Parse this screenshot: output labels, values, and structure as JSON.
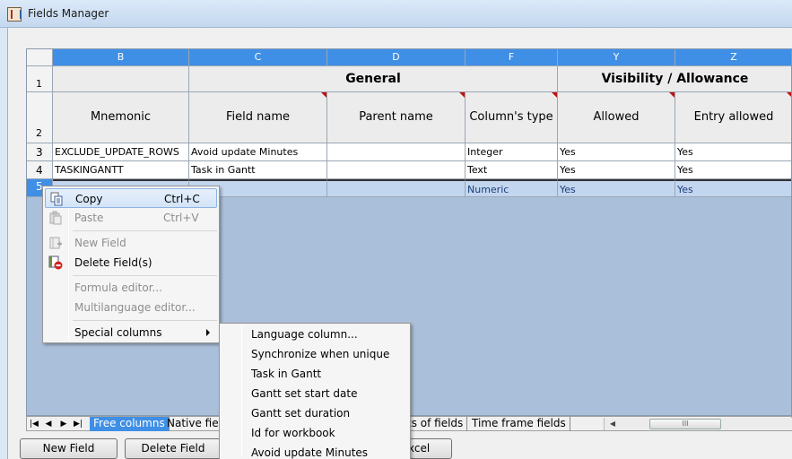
{
  "window": {
    "title": "Fields Manager"
  },
  "grid": {
    "columns": [
      {
        "letter": "B"
      },
      {
        "letter": "C"
      },
      {
        "letter": "D"
      },
      {
        "letter": "F"
      },
      {
        "letter": "Y"
      },
      {
        "letter": "Z"
      }
    ],
    "rows": [
      "1",
      "2",
      "3",
      "4",
      "5"
    ],
    "groups": {
      "general": "General",
      "visibility": "Visibility / Allowance"
    },
    "headers": {
      "mnemonic": "Mnemonic",
      "field_name": "Field name",
      "parent_name": "Parent name",
      "column_type": "Column's type",
      "allowed": "Allowed",
      "entry_allowed": "Entry allowed"
    },
    "data": [
      {
        "mnemonic": "EXCLUDE_UPDATE_ROWS",
        "field_name": "Avoid update Minutes",
        "parent_name": "",
        "column_type": "Integer",
        "allowed": "Yes",
        "entry_allowed": "Yes"
      },
      {
        "mnemonic": "TASKINGANTT",
        "field_name": "Task in Gantt",
        "parent_name": "",
        "column_type": "Text",
        "allowed": "Yes",
        "entry_allowed": "Yes"
      },
      {
        "mnemonic": "",
        "field_name": "",
        "parent_name": "",
        "column_type": "Numeric",
        "allowed": "Yes",
        "entry_allowed": "Yes"
      }
    ]
  },
  "tabs": {
    "items": [
      "Free columns",
      "Native fiel",
      "ts of fields",
      "Time frame fields"
    ],
    "scroll_thumb": "III"
  },
  "buttons": {
    "new_field": "New Field",
    "delete_field": "Delete Field",
    "excel": "xcel"
  },
  "context_menu": {
    "copy": {
      "label": "Copy",
      "shortcut": "Ctrl+C"
    },
    "paste": {
      "label": "Paste",
      "shortcut": "Ctrl+V"
    },
    "new_field": {
      "label": "New Field"
    },
    "delete_fields": {
      "label": "Delete Field(s)"
    },
    "formula_editor": {
      "label": "Formula editor..."
    },
    "multilanguage_editor": {
      "label": "Multilanguage editor..."
    },
    "special_columns": {
      "label": "Special columns"
    }
  },
  "submenu": [
    "Language column...",
    "Synchronize when unique",
    "Task in Gantt",
    "Gantt set start date",
    "Gantt set duration",
    "Id for workbook",
    "Avoid update Minutes"
  ],
  "colors": {
    "accent": "#3f8fe6",
    "grid_bg": "#aabfd9",
    "selected_row": "#c3d6ef",
    "marker": "#c01010"
  }
}
